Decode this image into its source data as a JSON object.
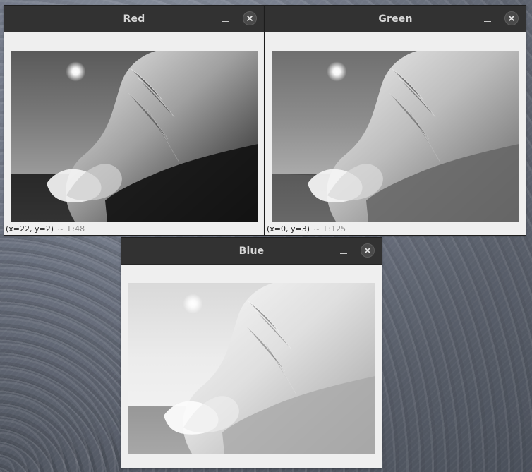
{
  "desktop": {
    "accent_color": "#6b7280"
  },
  "windows": {
    "red": {
      "title": "Red",
      "status_coords": "(x=22, y=2)",
      "status_separator": "~",
      "status_level": "L:48"
    },
    "green": {
      "title": "Green",
      "status_coords": "(x=0, y=3)",
      "status_separator": "~",
      "status_level": "L:125"
    },
    "blue": {
      "title": "Blue"
    }
  },
  "icons": {
    "minimize": "minimize-icon",
    "close": "close-icon"
  },
  "colors": {
    "titlebar_bg": "#323232",
    "window_bg": "#efefef",
    "title_text": "#d6d6d6"
  }
}
